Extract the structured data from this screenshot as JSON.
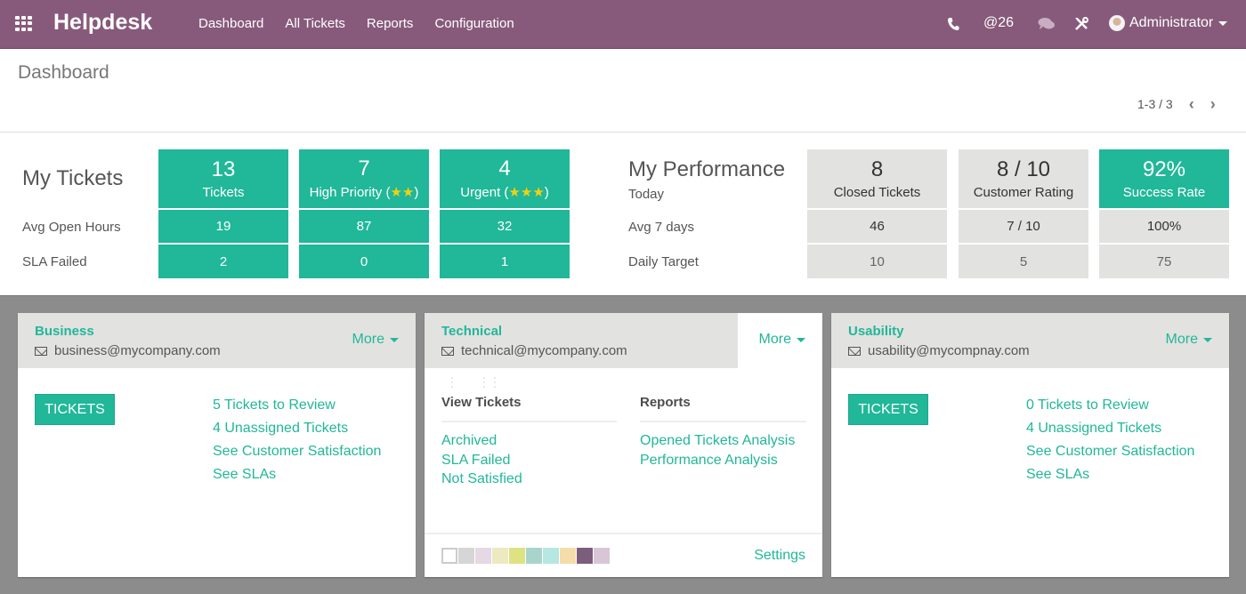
{
  "navbar": {
    "brand": "Helpdesk",
    "menu": [
      "Dashboard",
      "All Tickets",
      "Reports",
      "Configuration"
    ],
    "mentions_count": "@26",
    "user_name": "Administrator",
    "icons": {
      "apps": "apps-grid-icon",
      "phone": "phone-icon",
      "chat": "chat-icon",
      "tools": "tools-icon"
    }
  },
  "control_panel": {
    "breadcrumb": "Dashboard",
    "pager": "1-3 / 3",
    "prev_symbol": "‹",
    "next_symbol": "›"
  },
  "my_tickets": {
    "title": "My Tickets",
    "row_labels": [
      "Avg Open Hours",
      "SLA Failed"
    ],
    "columns": [
      {
        "count": "13",
        "label": "Tickets",
        "stars": "",
        "avg_open_hours": "19",
        "sla_failed": "2"
      },
      {
        "count": "7",
        "label": "High Priority (",
        "stars": "★★",
        "suffix": ")",
        "avg_open_hours": "87",
        "sla_failed": "0"
      },
      {
        "count": "4",
        "label": "Urgent (",
        "stars": "★★★",
        "suffix": ")",
        "avg_open_hours": "32",
        "sla_failed": "1"
      }
    ]
  },
  "my_performance": {
    "title": "My Performance",
    "row_labels": [
      "Today",
      "Avg 7 days",
      "Daily Target"
    ],
    "columns": [
      {
        "today": "8",
        "label": "Closed Tickets",
        "avg_7_days": "46",
        "daily_target": "10"
      },
      {
        "today": "8 / 10",
        "label": "Customer Rating",
        "avg_7_days": "7 / 10",
        "daily_target": "5"
      },
      {
        "today": "92%",
        "label": "Success Rate",
        "avg_7_days": "100%",
        "daily_target": "75"
      }
    ]
  },
  "teams": [
    {
      "name": "Business",
      "email": "business@mycompany.com",
      "more_label": "More",
      "button_label": "TICKETS",
      "links": [
        "5 Tickets to Review",
        "4 Unassigned Tickets",
        "See Customer Satisfaction",
        "See SLAs"
      ]
    },
    {
      "name": "Technical",
      "email": "technical@mycompany.com",
      "more_label": "More",
      "view_tickets": {
        "heading": "View Tickets",
        "links": [
          "Archived",
          "SLA Failed",
          "Not Satisfied"
        ]
      },
      "reports": {
        "heading": "Reports",
        "links": [
          "Opened Tickets Analysis",
          "Performance Analysis"
        ]
      },
      "settings_label": "Settings",
      "color_options": [
        "#ffffff",
        "#d6d6d6",
        "#e6d8e4",
        "#ede9c0",
        "#dee283",
        "#a8d5cb",
        "#b6e7e2",
        "#f5dcaa",
        "#7b5e7b",
        "#d8c6d6"
      ]
    },
    {
      "name": "Usability",
      "email": "usability@mycompnay.com",
      "more_label": "More",
      "button_label": "TICKETS",
      "links": [
        "0 Tickets to Review",
        "4 Unassigned Tickets",
        "See Customer Satisfaction",
        "See SLAs"
      ]
    }
  ],
  "colors": {
    "navbar": "#875a7b",
    "accent_green": "#21b799",
    "grey_tile": "#e2e2e0",
    "star": "#f3d10e"
  }
}
